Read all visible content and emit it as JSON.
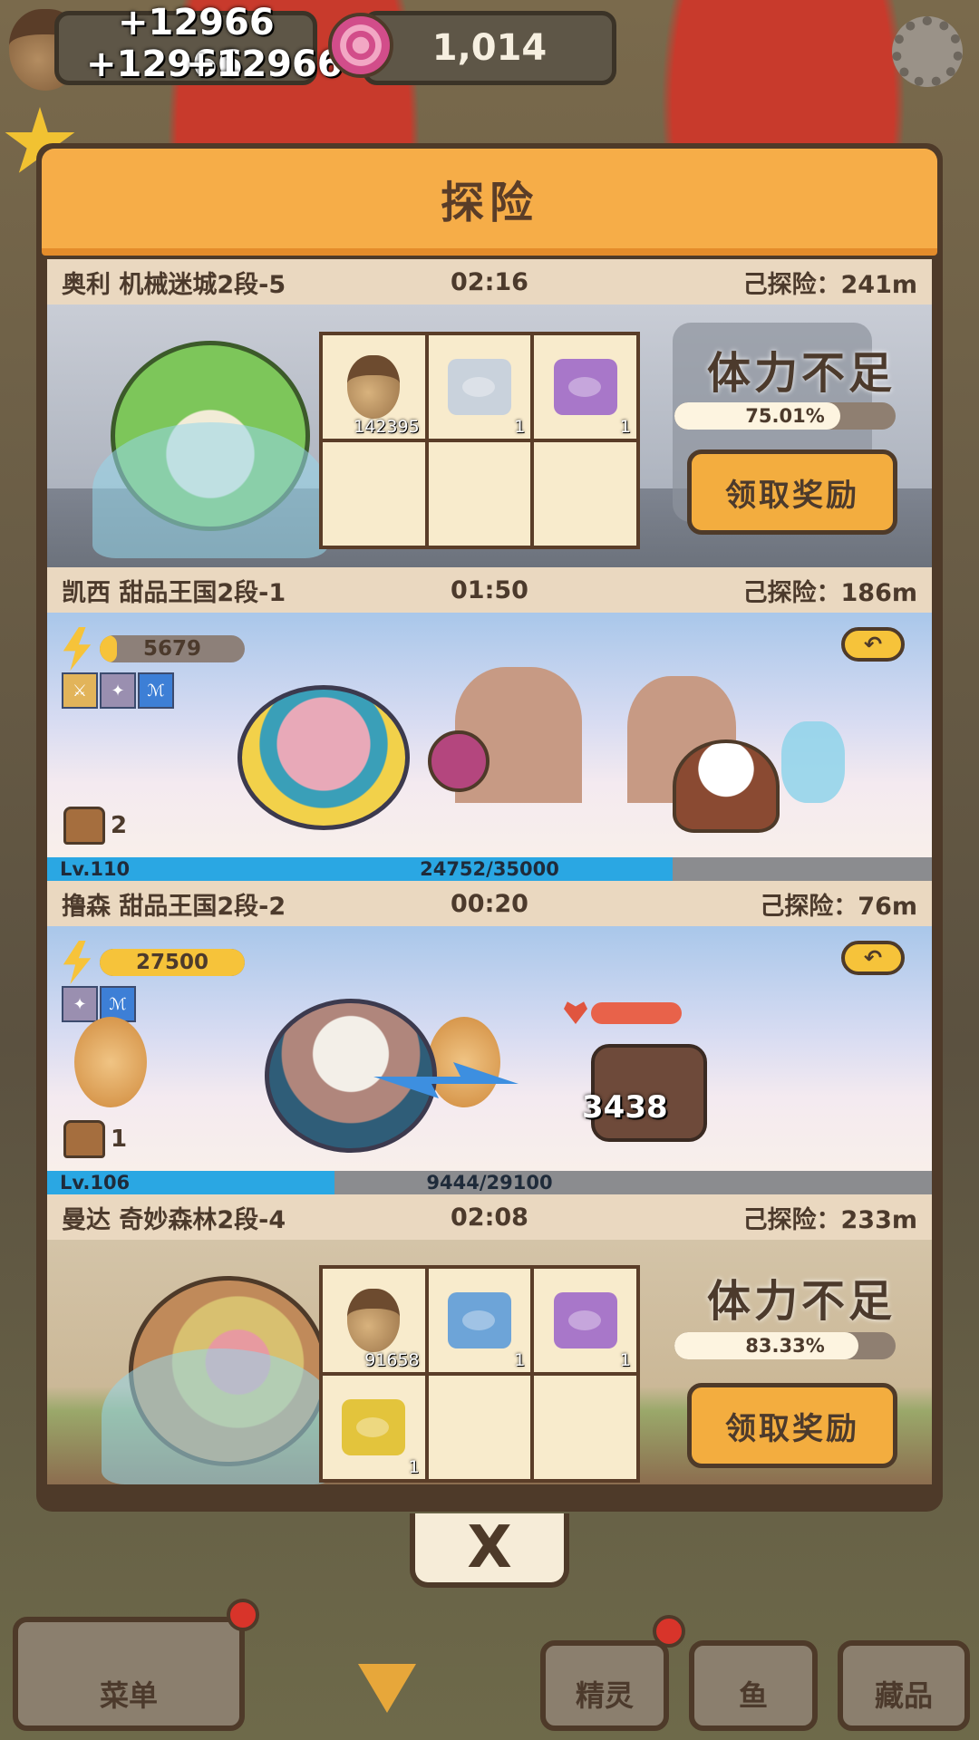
{
  "hud": {
    "float_numbers": [
      "+12966",
      "+12966",
      "+12966"
    ],
    "candy_count": "1,014"
  },
  "panel": {
    "title": "探险",
    "close_label": "X"
  },
  "expeditions": [
    {
      "header": {
        "name": "奥利 机械迷城2段-5",
        "time": "02:16",
        "explored": "己探险：241m"
      },
      "rewards": [
        {
          "count": "142395"
        },
        {
          "count": "1"
        },
        {
          "count": "1"
        }
      ],
      "status": "体力不足",
      "progress": 0.7501,
      "progress_label": "75.01%",
      "claim_label": "领取奖励"
    },
    {
      "header": {
        "name": "凯西 甜品王国2段-1",
        "time": "01:50",
        "explored": "己探险：186m"
      },
      "energy": {
        "value": "5679",
        "fill": 0.1
      },
      "skills": [
        "⚔",
        "✦",
        "ℳ"
      ],
      "bag_count": "2",
      "level": "Lv.110",
      "xp_label": "24752/35000",
      "xp_ratio": 0.7072
    },
    {
      "header": {
        "name": "撸森 甜品王国2段-2",
        "time": "00:20",
        "explored": "己探险：76m"
      },
      "energy": {
        "value": "27500",
        "fill": 1.0
      },
      "skills": [
        "✦",
        "ℳ"
      ],
      "bag_count": "1",
      "damage": "3438",
      "level": "Lv.106",
      "xp_label": "9444/29100",
      "xp_ratio": 0.3245
    },
    {
      "header": {
        "name": "曼达 奇妙森林2段-4",
        "time": "02:08",
        "explored": "己探险：233m"
      },
      "rewards": [
        {
          "count": "91658"
        },
        {
          "count": "1"
        },
        {
          "count": "1"
        },
        {
          "count": "1"
        }
      ],
      "status": "体力不足",
      "progress": 0.8333,
      "progress_label": "83.33%",
      "claim_label": "领取奖励"
    }
  ],
  "nav": {
    "menu": "菜单",
    "sprite": "精灵",
    "fish": "鱼",
    "collection": "藏品"
  },
  "colors": {
    "panel_orange": "#f6ad48",
    "claim_button": "#f3ad3f",
    "xp_blue": "#2aa7e3",
    "energy_yellow": "#f6c33a"
  }
}
